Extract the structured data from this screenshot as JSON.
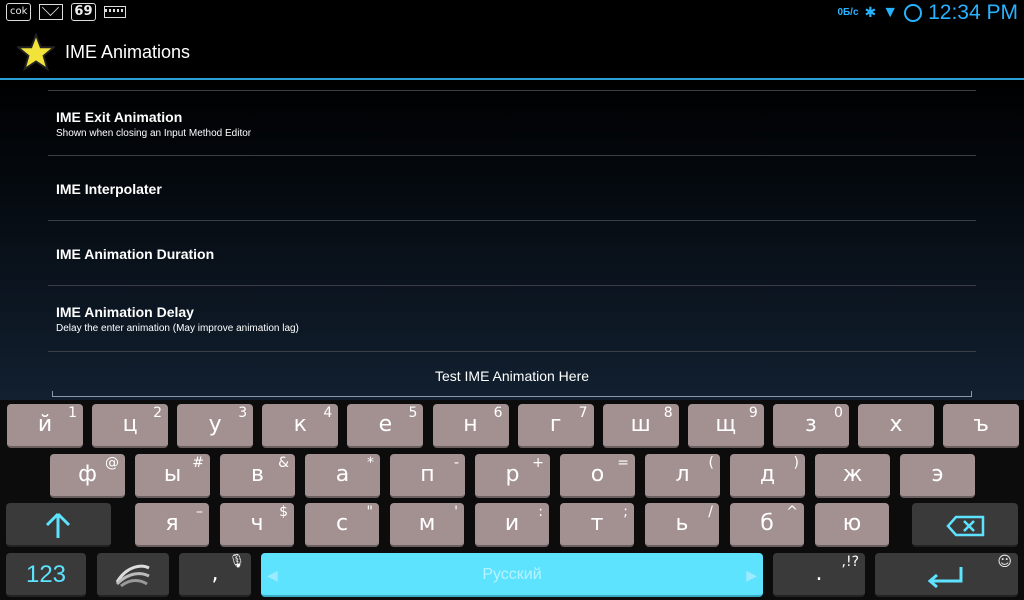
{
  "status_bar": {
    "left_icons": [
      "ok-icon",
      "mail-icon",
      "badge-69-icon",
      "keyboard-icon"
    ],
    "ok_label": "cok",
    "badge": "69",
    "net_speed": "0Б/с",
    "time": "12:34 PM",
    "accent": "#27b3ff"
  },
  "action_bar": {
    "title": "IME Animations",
    "icon": "star-icon",
    "underline_color": "#2a9fd6"
  },
  "settings": [
    {
      "title": "IME Exit Animation",
      "summary": "Shown when closing an Input Method Editor"
    },
    {
      "title": "IME Interpolater",
      "summary": ""
    },
    {
      "title": "IME Animation Duration",
      "summary": ""
    },
    {
      "title": "IME Animation Delay",
      "summary": "Delay the enter animation (May improve animation lag)"
    }
  ],
  "test_field": {
    "placeholder": "Test IME Animation Here"
  },
  "keyboard": {
    "row1": [
      {
        "m": "й",
        "h": "1"
      },
      {
        "m": "ц",
        "h": "2"
      },
      {
        "m": "у",
        "h": "3"
      },
      {
        "m": "к",
        "h": "4"
      },
      {
        "m": "е",
        "h": "5"
      },
      {
        "m": "н",
        "h": "6"
      },
      {
        "m": "г",
        "h": "7"
      },
      {
        "m": "ш",
        "h": "8"
      },
      {
        "m": "щ",
        "h": "9"
      },
      {
        "m": "з",
        "h": "0"
      },
      {
        "m": "х",
        "h": ""
      },
      {
        "m": "ъ",
        "h": ""
      }
    ],
    "row2": [
      {
        "m": "ф",
        "h": "@"
      },
      {
        "m": "ы",
        "h": "#"
      },
      {
        "m": "в",
        "h": "&"
      },
      {
        "m": "а",
        "h": "*"
      },
      {
        "m": "п",
        "h": "-"
      },
      {
        "m": "р",
        "h": "+"
      },
      {
        "m": "о",
        "h": "="
      },
      {
        "m": "л",
        "h": "("
      },
      {
        "m": "д",
        "h": ")"
      },
      {
        "m": "ж",
        "h": ""
      },
      {
        "m": "э",
        "h": ""
      }
    ],
    "row3": [
      {
        "m": "я",
        "h": "–"
      },
      {
        "m": "ч",
        "h": "$"
      },
      {
        "m": "с",
        "h": "\""
      },
      {
        "m": "м",
        "h": "'"
      },
      {
        "m": "и",
        "h": ":"
      },
      {
        "m": "т",
        "h": ";"
      },
      {
        "m": "ь",
        "h": "/"
      },
      {
        "m": "б",
        "h": "^"
      },
      {
        "m": "ю",
        "h": ""
      }
    ],
    "shift_icon": "shift-arrow-icon",
    "backspace_icon": "backspace-icon",
    "numbers_label": "123",
    "swype_icon": "swype-logo-icon",
    "comma": ",",
    "mic_hint": "mic-icon",
    "space_label": "Русский",
    "period": ".",
    "period_hint": ",!?",
    "enter_icon": "enter-icon",
    "emoji_hint": "smiley-icon",
    "key_color": "#a39192",
    "space_color": "#5ee3ff"
  }
}
